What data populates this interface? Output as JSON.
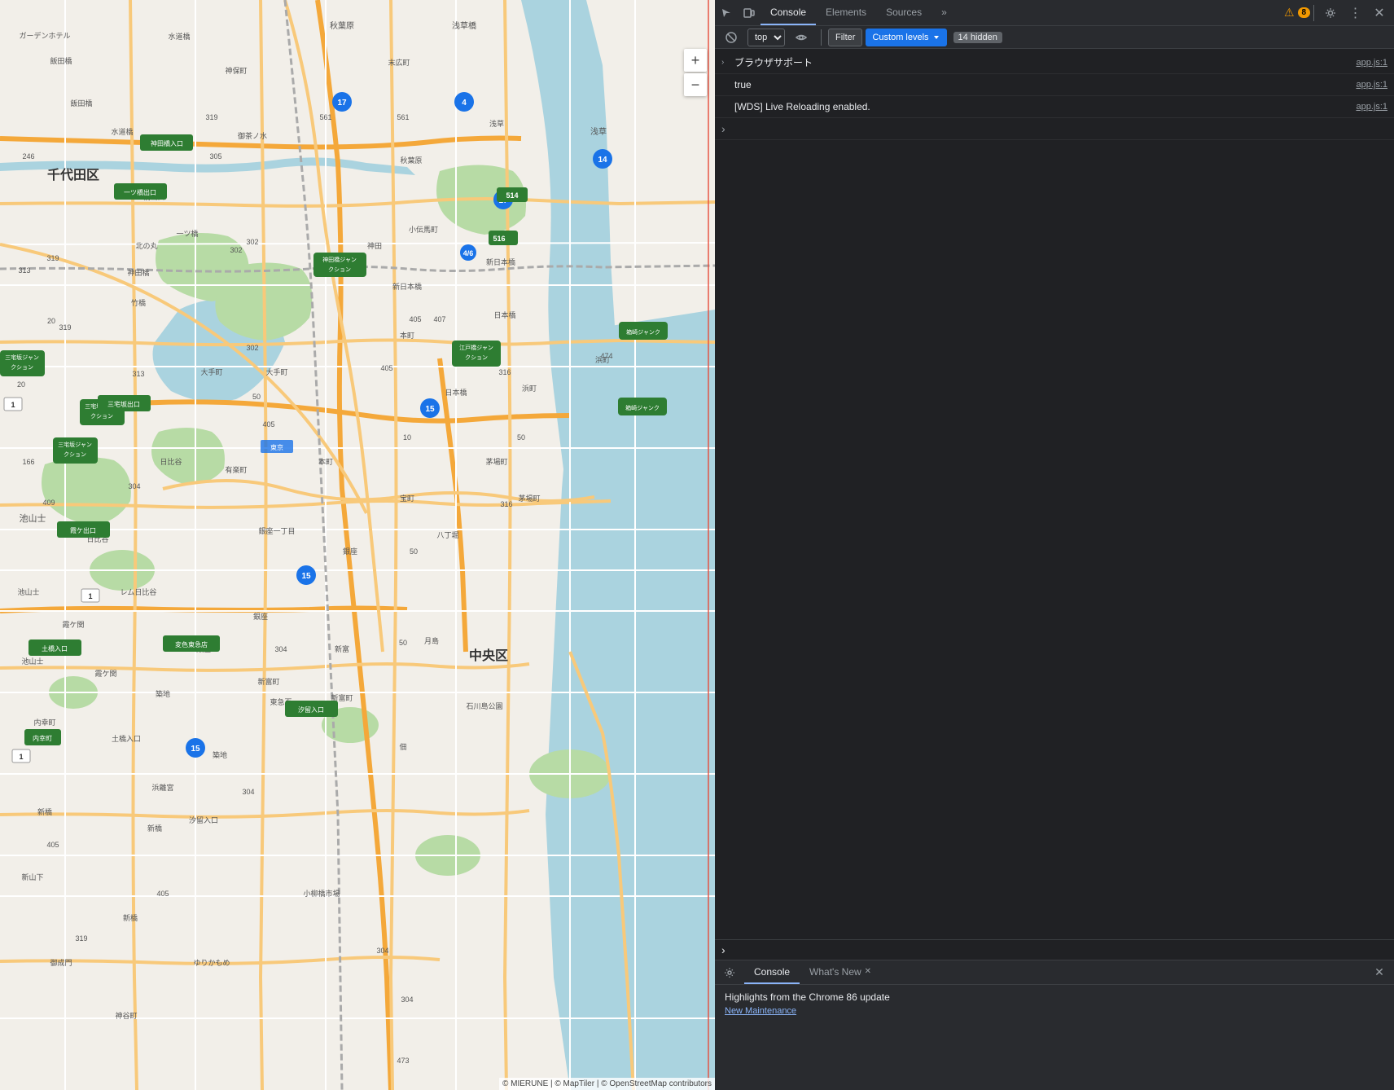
{
  "map": {
    "attribution": "© MIERUNE | © MapTiler | © OpenStreetMap contributors",
    "zoom_in_label": "+",
    "zoom_out_label": "−"
  },
  "devtools": {
    "tabs": [
      {
        "id": "console",
        "label": "Console",
        "active": true
      },
      {
        "id": "elements",
        "label": "Elements",
        "active": false
      },
      {
        "id": "sources",
        "label": "Sources",
        "active": false
      }
    ],
    "more_tabs_label": "»",
    "warning_count": "8",
    "toolbar_icons": [
      "inspect",
      "device",
      "settings",
      "more",
      "close"
    ],
    "console_toolbar": {
      "clear_label": "🚫",
      "filter_label": "Filter",
      "levels_label": "Custom levels",
      "hidden_count": "14 hidden",
      "context_value": "top"
    },
    "console_messages": [
      {
        "text": "ブラウザサポート",
        "source": "app.js:1",
        "type": "normal"
      },
      {
        "text": "true",
        "source": "app.js:1",
        "type": "normal"
      },
      {
        "text": "[WDS] Live Reloading enabled.",
        "source": "app.js:1",
        "type": "normal"
      }
    ],
    "expand_arrow": "›",
    "bottom_panel": {
      "tabs": [
        {
          "id": "console-tab",
          "label": "Console",
          "active": true,
          "closeable": false
        },
        {
          "id": "whats-new-tab",
          "label": "What's New",
          "active": false,
          "closeable": true
        }
      ],
      "whats_new_title": "Highlights from the Chrome 86 update",
      "whats_new_subtitle": "New Maintenance"
    }
  }
}
